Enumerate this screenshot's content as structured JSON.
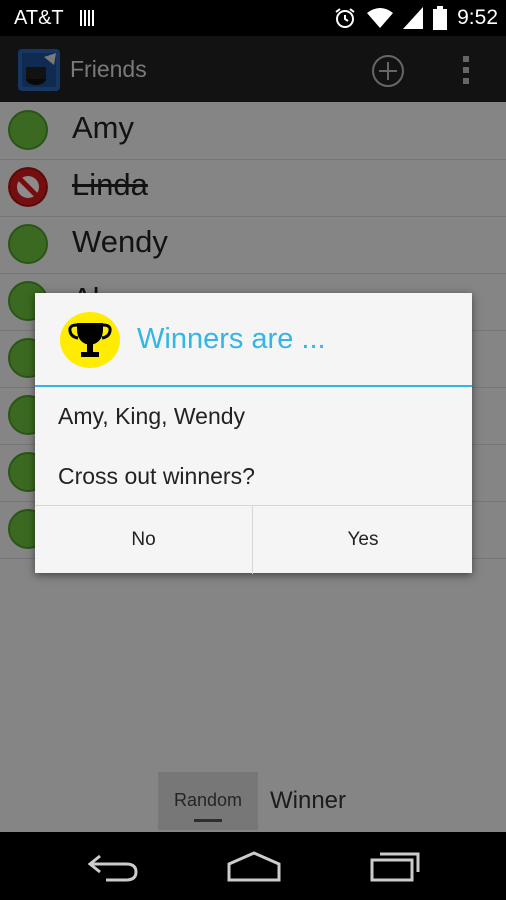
{
  "status_bar": {
    "carrier": "AT&T",
    "time": "9:52"
  },
  "action_bar": {
    "title": "Friends"
  },
  "friends": [
    {
      "name": "Amy",
      "status": "available"
    },
    {
      "name": "Linda",
      "status": "excluded"
    },
    {
      "name": "Wendy",
      "status": "available"
    },
    {
      "name": "Al",
      "status": "available"
    },
    {
      "name": "",
      "status": "available"
    },
    {
      "name": "",
      "status": "available"
    },
    {
      "name": "",
      "status": "available"
    },
    {
      "name": "",
      "status": "available"
    }
  ],
  "bottom_bar": {
    "random_label": "Random",
    "winner_label": "Winner"
  },
  "dialog": {
    "title": "Winners are ...",
    "winners": "Amy, King, Wendy",
    "question": "Cross out winners?",
    "no_label": "No",
    "yes_label": "Yes"
  },
  "colors": {
    "accent": "#33b5e5",
    "available": "#6cbf3c",
    "excluded": "#d51a1a"
  }
}
